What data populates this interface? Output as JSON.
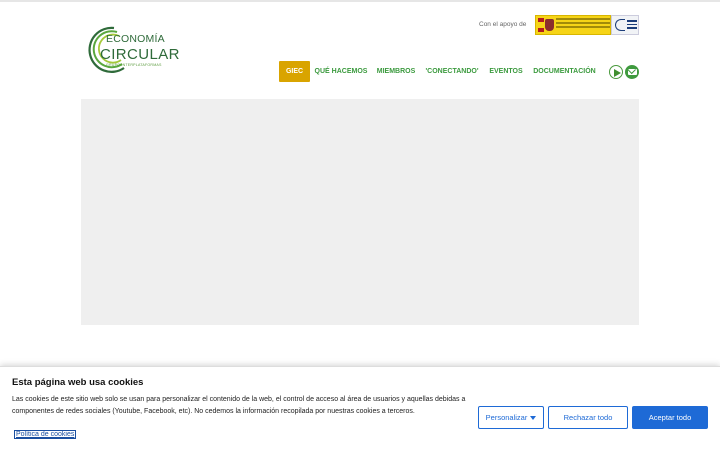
{
  "logo": {
    "line1": "ECONOMÍA",
    "line2": "CIRCULAR",
    "line3": "GRUPO INTERPLATAFORMAS",
    "icon": "circular-economy-logo"
  },
  "support": {
    "label": "Con el apoyo de",
    "gov_logo": "gobierno-de-espana-logo",
    "aux_logo": "agencia-logo"
  },
  "nav": {
    "items": [
      {
        "label": "GIEC",
        "active": true
      },
      {
        "label": "QUÉ HACEMOS",
        "active": false
      },
      {
        "label": "MIEMBROS",
        "active": false
      },
      {
        "label": "'CONECTANDO'",
        "active": false
      },
      {
        "label": "EVENTOS",
        "active": false
      },
      {
        "label": "DOCUMENTACIÓN",
        "active": false
      }
    ],
    "social": [
      "youtube-icon",
      "mail-icon"
    ]
  },
  "colors": {
    "accent_green": "#3b9a3e",
    "active_gold": "#d9a400",
    "button_blue": "#1e6ad6"
  },
  "cookies": {
    "title": "Esta página web usa cookies",
    "text": "Las cookies de este sitio web solo se usan para personalizar el contenido de la web, el control de acceso al área de usuarios y aquellas debidas a componentes de redes sociales (Youtube, Facebook, etc). No cedemos la información recopilada por nuestras cookies a terceros.",
    "policy_link": "Política de cookies",
    "customize_label": "Personalizar",
    "reject_label": "Rechazar todo",
    "accept_label": "Aceptar todo"
  }
}
